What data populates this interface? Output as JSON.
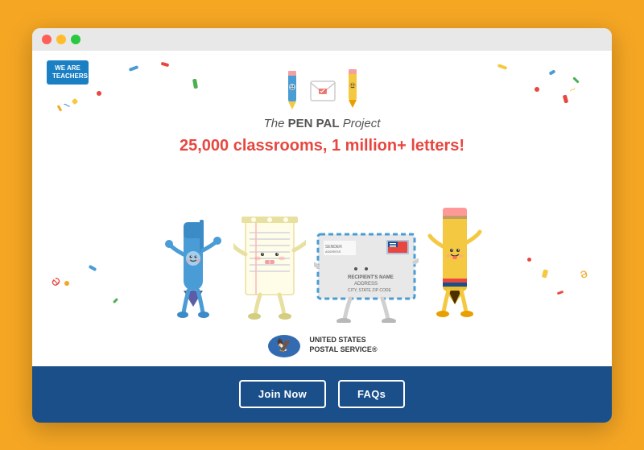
{
  "browser": {
    "dots": [
      "red",
      "yellow",
      "green"
    ]
  },
  "badge": {
    "line1": "WE ARE",
    "line2": "TEACHERS"
  },
  "logo": {
    "title_pre": "The ",
    "title_pen": "PEN",
    "title_pal": "PAL",
    "title_post": " Project"
  },
  "tagline": "25,000 classrooms, 1 million+ letters!",
  "usps": {
    "line1": "UNITED STATES",
    "line2": "POSTAL SERVICE",
    "registered": "®"
  },
  "buttons": {
    "join": "Join Now",
    "faq": "FAQs"
  },
  "envelope": {
    "sender": "SENDER",
    "address_line1": "ADDRESS",
    "city_state_zip": "CITY, STATE  ZIP CODE",
    "recipient": "RECIPIENT'S NAME",
    "rec_address": "ADDRESS",
    "rec_city": "CITY, STATE  ZIP CODE"
  }
}
